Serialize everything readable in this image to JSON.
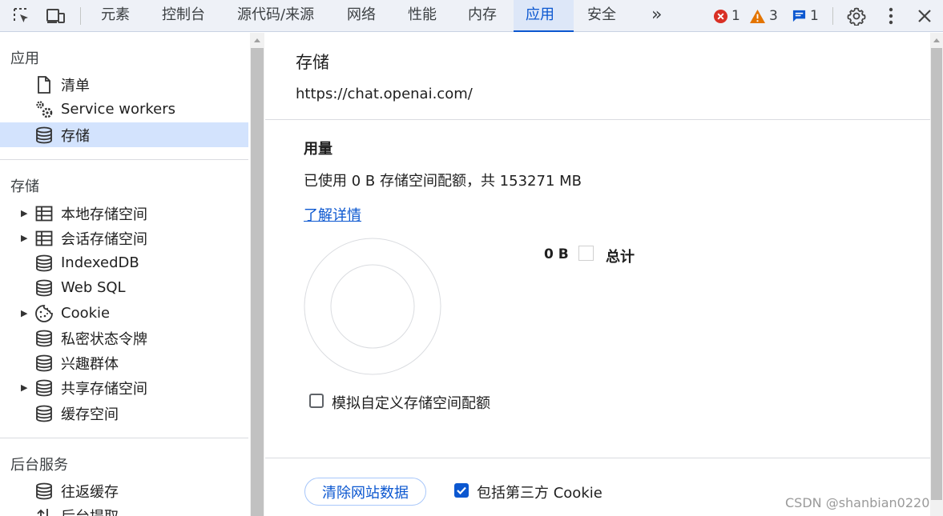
{
  "toolbar": {
    "tabs": [
      {
        "label": "元素"
      },
      {
        "label": "控制台"
      },
      {
        "label": "源代码/来源"
      },
      {
        "label": "网络"
      },
      {
        "label": "性能"
      },
      {
        "label": "内存"
      },
      {
        "label": "应用"
      },
      {
        "label": "安全"
      }
    ],
    "more_label": "»",
    "errors_count": "1",
    "warnings_count": "3",
    "messages_count": "1",
    "colors": {
      "accent": "#0b57d0",
      "error": "#d93025",
      "warning": "#e37400"
    }
  },
  "sidebar": {
    "app_section": {
      "title": "应用",
      "items": [
        {
          "label": "清单",
          "icon": "document-icon"
        },
        {
          "label": "Service workers",
          "icon": "gears-icon"
        },
        {
          "label": "存储",
          "icon": "database-icon"
        }
      ]
    },
    "storage_section": {
      "title": "存储",
      "items": [
        {
          "label": "本地存储空间",
          "icon": "table-icon"
        },
        {
          "label": "会话存储空间",
          "icon": "table-icon"
        },
        {
          "label": "IndexedDB",
          "icon": "database-icon"
        },
        {
          "label": "Web SQL",
          "icon": "database-icon"
        },
        {
          "label": "Cookie",
          "icon": "cookie-icon"
        },
        {
          "label": "私密状态令牌",
          "icon": "database-icon"
        },
        {
          "label": "兴趣群体",
          "icon": "database-icon"
        },
        {
          "label": "共享存储空间",
          "icon": "database-icon"
        },
        {
          "label": "缓存空间",
          "icon": "database-icon"
        }
      ]
    },
    "background_section": {
      "title": "后台服务",
      "items": [
        {
          "label": "往返缓存",
          "icon": "database-icon"
        },
        {
          "label": "后台提取",
          "icon": "arrows-icon"
        }
      ]
    }
  },
  "main": {
    "title": "存储",
    "origin": "https://chat.openai.com/",
    "usage": {
      "heading": "用量",
      "text": "已使用 0 B 存储空间配额，共 153271 MB",
      "learn_more": "了解详情",
      "legend_value": "0 B",
      "legend_label": "总计"
    },
    "simulate_quota_label": "模拟自定义存储空间配额",
    "clear_button": "清除网站数据",
    "include_third_party_label": "包括第三方 Cookie",
    "include_third_party_checked": true
  },
  "watermark": "CSDN @shanbian0220"
}
